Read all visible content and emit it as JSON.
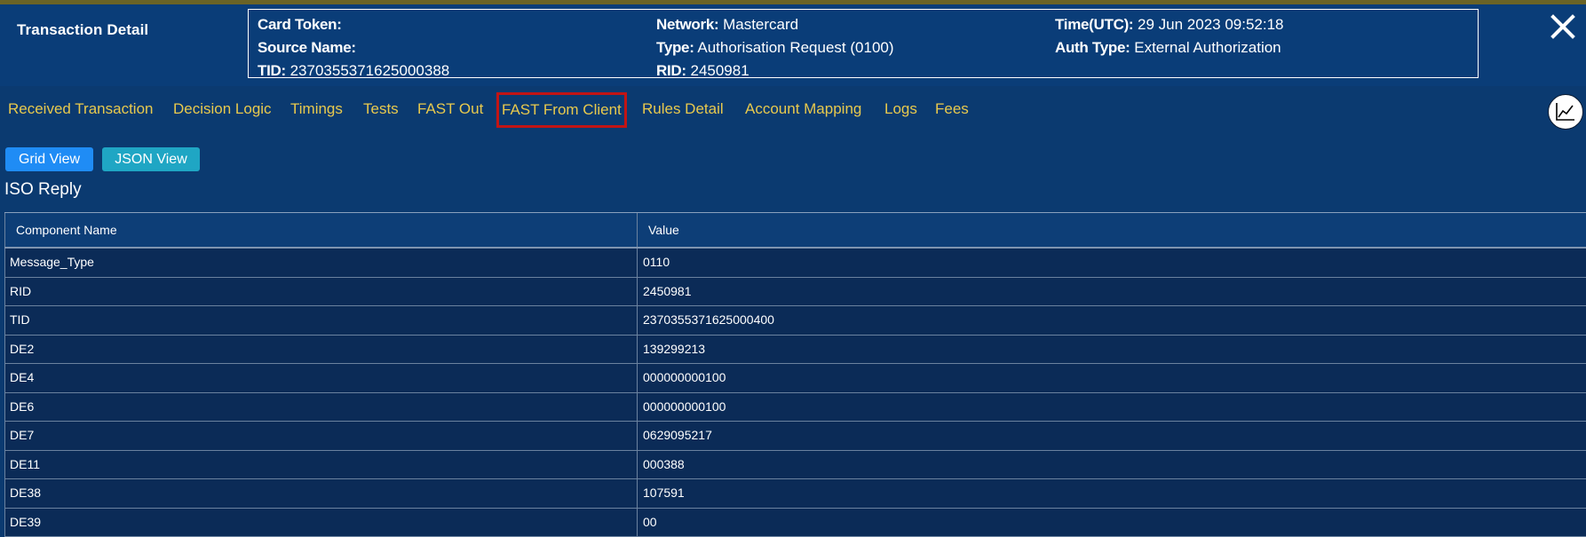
{
  "header": {
    "title": "Transaction Detail",
    "info": {
      "col1": [
        {
          "label": "Card Token:",
          "value": ""
        },
        {
          "label": "Source Name:",
          "value": ""
        },
        {
          "label": "TID:",
          "value": "2370355371625000388"
        }
      ],
      "col2": [
        {
          "label": "Network:",
          "value": "Mastercard"
        },
        {
          "label": "Type:",
          "value": "Authorisation Request (0100)"
        },
        {
          "label": "RID:",
          "value": "2450981"
        }
      ],
      "col3": [
        {
          "label": "Time(UTC):",
          "value": "29 Jun 2023 09:52:18"
        },
        {
          "label": "Auth Type:",
          "value": "External Authorization"
        }
      ]
    },
    "close_icon": "close-icon"
  },
  "tabs": [
    {
      "label": "Received Transaction"
    },
    {
      "label": "Decision Logic"
    },
    {
      "label": "Timings"
    },
    {
      "label": "Tests"
    },
    {
      "label": "FAST Out"
    },
    {
      "label": "FAST From Client",
      "active": true
    },
    {
      "label": "Rules Detail"
    },
    {
      "label": "Account Mapping"
    },
    {
      "label": "Logs"
    },
    {
      "label": "Fees"
    }
  ],
  "chart_icon": "line-chart-icon",
  "view_buttons": {
    "grid": "Grid View",
    "json": "JSON View"
  },
  "section_title": "ISO Reply",
  "table": {
    "headers": [
      "Component Name",
      "Value"
    ],
    "rows": [
      [
        "Message_Type",
        "0110"
      ],
      [
        "RID",
        "2450981"
      ],
      [
        "TID",
        "2370355371625000400"
      ],
      [
        "DE2",
        "139299213"
      ],
      [
        "DE4",
        "000000000100"
      ],
      [
        "DE6",
        "000000000100"
      ],
      [
        "DE7",
        "0629095217"
      ],
      [
        "DE11",
        "000388"
      ],
      [
        "DE38",
        "107591"
      ],
      [
        "DE39",
        "00"
      ]
    ]
  },
  "colors": {
    "background": "#0b3a70",
    "tab_text": "#e8c94d",
    "active_tab_border": "#c21414",
    "grid_button": "#1f8cf5",
    "json_button": "#1fa6c4"
  }
}
